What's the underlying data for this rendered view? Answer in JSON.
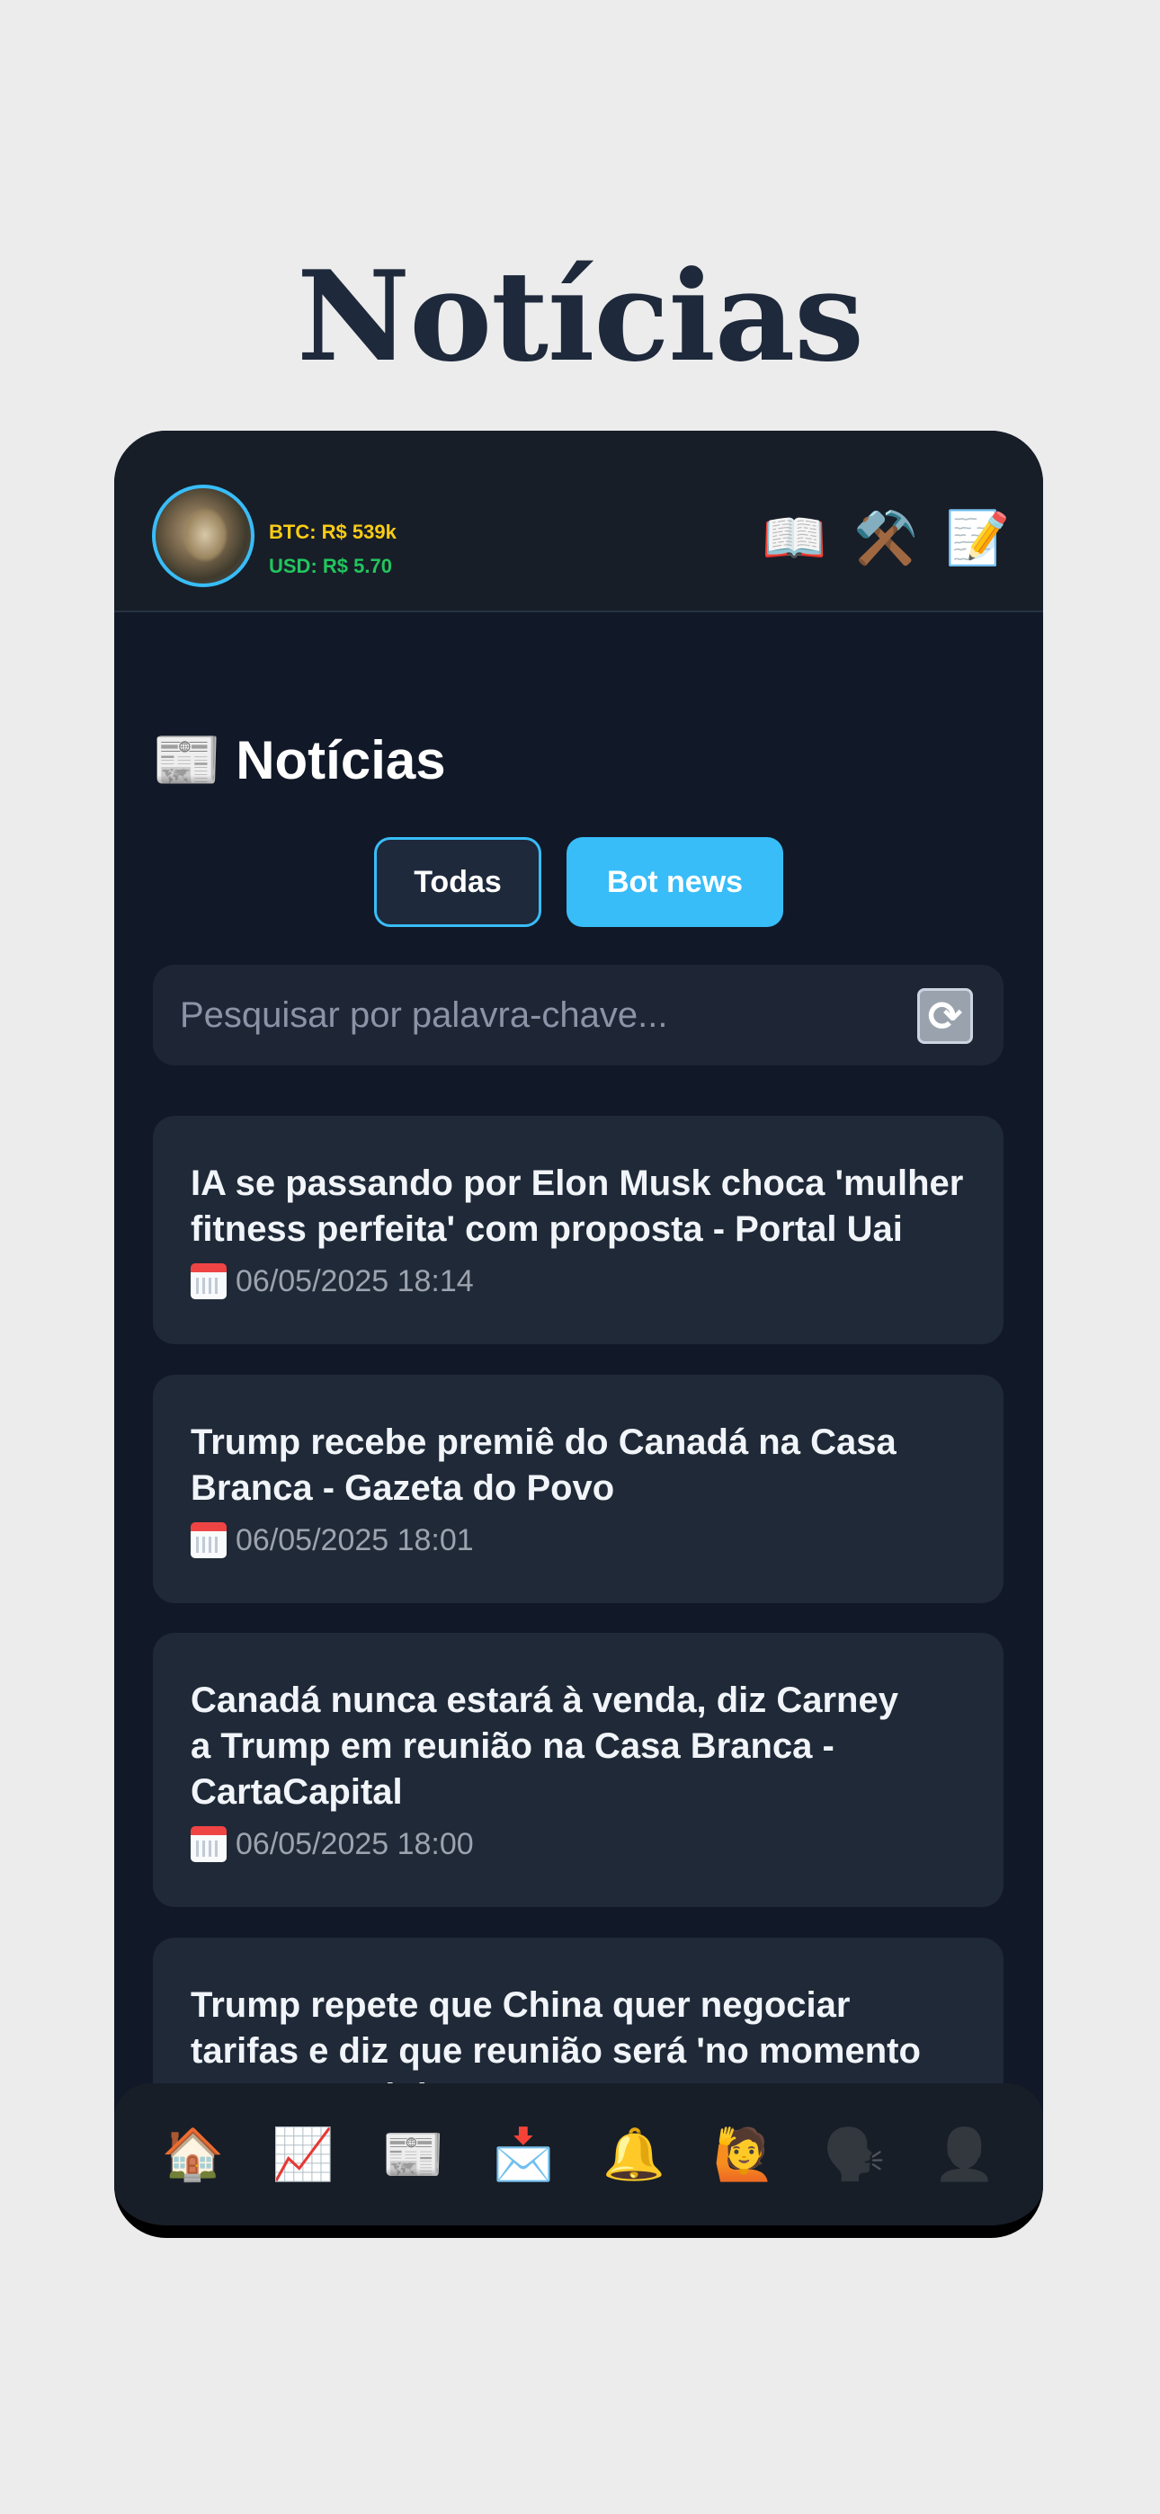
{
  "page": {
    "heading": "Notícias"
  },
  "topbar": {
    "btc": "BTC: R$ 539k",
    "usd": "USD: R$ 5.70",
    "icons": [
      {
        "name": "book-icon",
        "glyph": "📖"
      },
      {
        "name": "tools-icon",
        "glyph": "⚒️"
      },
      {
        "name": "memo-icon",
        "glyph": "📝"
      }
    ]
  },
  "section": {
    "icon": "📰",
    "title": "Notícias"
  },
  "tabs": {
    "all": "Todas",
    "bot": "Bot news"
  },
  "search": {
    "placeholder": "Pesquisar por palavra-chave...",
    "refresh_icon": "🔄"
  },
  "news": [
    {
      "title": "IA se passando por Elon Musk choca 'mulher fitness perfeita' com proposta - Portal Uai",
      "date": "06/05/2025 18:14"
    },
    {
      "title": "Trump recebe premiê do Canadá na Casa Branca - Gazeta do Povo",
      "date": "06/05/2025 18:01"
    },
    {
      "title": "Canadá nunca estará à venda, diz Carney a Trump em reunião na Casa Branca - CartaCapital",
      "date": "06/05/2025 18:00"
    },
    {
      "title": "Trump repete que China quer negociar tarifas e diz que reunião será 'no momento certo' - O Globo",
      "date": ""
    }
  ],
  "bottom_nav": [
    {
      "name": "nav-home-icon",
      "glyph": "🏠"
    },
    {
      "name": "nav-chart-icon",
      "glyph": "📈"
    },
    {
      "name": "nav-news-icon",
      "glyph": "📰"
    },
    {
      "name": "nav-inbox-icon",
      "glyph": "📩"
    },
    {
      "name": "nav-bell-icon",
      "glyph": "🔔"
    },
    {
      "name": "nav-raising-hand-icon",
      "glyph": "🙋"
    },
    {
      "name": "nav-speaking-head-icon",
      "glyph": "🗣️"
    },
    {
      "name": "nav-profile-icon",
      "glyph": "👤"
    }
  ]
}
